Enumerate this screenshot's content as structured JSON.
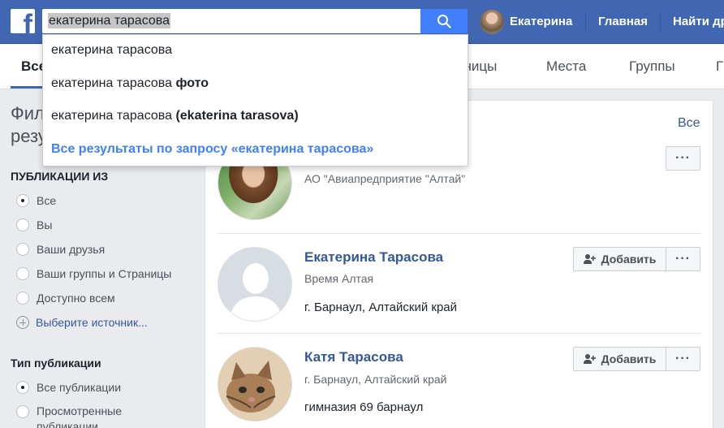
{
  "topbar": {
    "logo": "f",
    "search_value": "екатерина тарасова",
    "user_name": "Екатерина",
    "home_link": "Главная",
    "find_friends": "Найти др",
    "colors": {
      "bar": "#4267b2",
      "search_button": "#4080ff"
    }
  },
  "tabs": [
    {
      "label": "Все"
    },
    {
      "label": "аницы"
    },
    {
      "label": "Места"
    },
    {
      "label": "Группы"
    },
    {
      "label": "Г"
    }
  ],
  "dropdown": {
    "suggestions": [
      {
        "text": "екатерина тарасова",
        "bold": ""
      },
      {
        "text": "екатерина тарасова",
        "bold": "фото"
      },
      {
        "text": "екатерина тарасова",
        "bold": "(ekaterina tarasova)"
      }
    ],
    "see_all": "Все результаты по запросу «екатерина тарасова»"
  },
  "sidebar": {
    "title": "Фильтровать результаты",
    "posts_from_heading": "ПУБЛИКАЦИИ ИЗ",
    "posts_from": [
      {
        "label": "Все",
        "checked": true
      },
      {
        "label": "Вы",
        "checked": false
      },
      {
        "label": "Ваши друзья",
        "checked": false
      },
      {
        "label": "Ваши группы и Страницы",
        "checked": false
      },
      {
        "label": "Доступно всем",
        "checked": false
      }
    ],
    "choose_source": "Выберите источник...",
    "post_type_heading": "Тип публикации",
    "post_types": [
      {
        "label": "Все публикации",
        "checked": true
      },
      {
        "label": "Просмотренные публикации",
        "checked": false
      }
    ]
  },
  "results": {
    "see_all": "Все",
    "people": [
      {
        "name": "",
        "sub": "АО \"Авиапредприятие \"Алтай\"",
        "detail": "",
        "add_label": "",
        "more_label": "···",
        "avatar": "woman-photo"
      },
      {
        "name": "Екатерина Тарасова",
        "sub": "Время Алтая",
        "detail": "г. Барнаул, Алтайский край",
        "add_label": "Добавить",
        "more_label": "···",
        "avatar": "default-silhouette"
      },
      {
        "name": "Катя Тарасова",
        "sub": "г. Барнаул, Алтайский край",
        "detail": "гимназия 69 барнаул",
        "add_label": "Добавить",
        "more_label": "···",
        "avatar": "kitten-photo"
      }
    ]
  }
}
